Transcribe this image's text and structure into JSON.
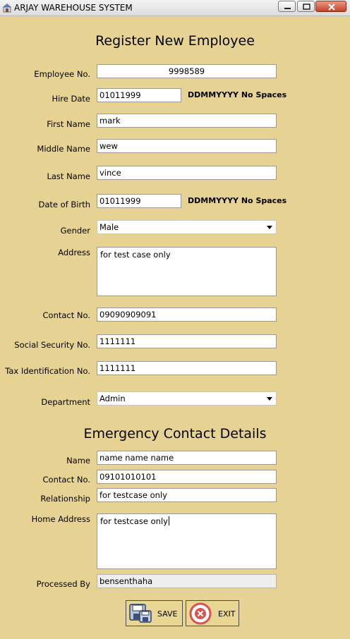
{
  "window": {
    "title": "ARJAY WAREHOUSE SYSTEM",
    "icons": [
      "building-icon",
      "minimize-icon",
      "maximize-icon",
      "close-icon"
    ]
  },
  "form": {
    "title": "Register New Employee",
    "fields": {
      "employee_no": {
        "label": "Employee No.",
        "value": "9998589"
      },
      "hire_date": {
        "label": "Hire Date",
        "value": "01011999",
        "hint": "DDMMYYYY No Spaces"
      },
      "first_name": {
        "label": "First Name",
        "value": "mark"
      },
      "middle_name": {
        "label": "Middle Name",
        "value": "wew"
      },
      "last_name": {
        "label": "Last Name",
        "value": "vince"
      },
      "date_of_birth": {
        "label": "Date of Birth",
        "value": "01011999",
        "hint": "DDMMYYYY No Spaces"
      },
      "gender": {
        "label": "Gender",
        "value": "Male"
      },
      "address": {
        "label": "Address",
        "value": "for test case only"
      },
      "contact_no": {
        "label": "Contact No.",
        "value": "09090909091"
      },
      "ssn": {
        "label": "Social Security No.",
        "value": "1111111"
      },
      "tin": {
        "label": "Tax Identification No.",
        "value": "1111111"
      },
      "department": {
        "label": "Department",
        "value": "Admin"
      }
    }
  },
  "emergency": {
    "title": "Emergency Contact Details",
    "fields": {
      "name": {
        "label": "Name",
        "value": "name name name"
      },
      "contact_no": {
        "label": "Contact No.",
        "value": "09101010101"
      },
      "relationship": {
        "label": "Relationship",
        "value": "for testcase only"
      },
      "home_address": {
        "label": "Home Address",
        "value": "for testcase only"
      },
      "processed_by": {
        "label": "Processed By",
        "value": "bensenthaha"
      }
    }
  },
  "actions": {
    "save_label": "SAVE",
    "exit_label": "EXIT"
  },
  "colors": {
    "background": "#e6d292",
    "exit_accent": "#d9534f",
    "close_button": "#c4432a"
  }
}
